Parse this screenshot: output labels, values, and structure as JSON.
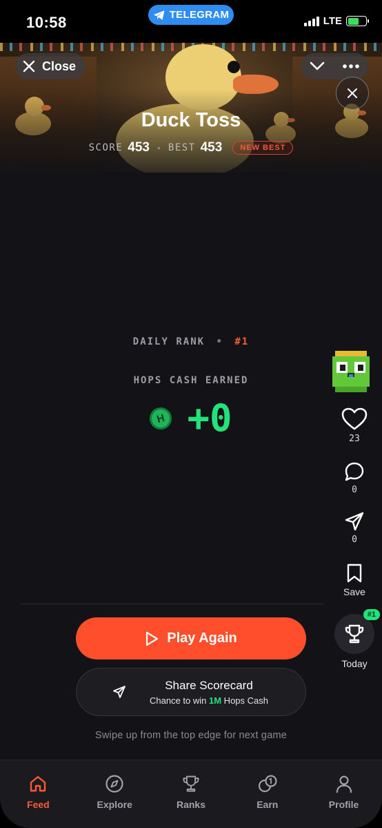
{
  "status_bar": {
    "time": "10:58",
    "app_pill": "TELEGRAM",
    "network": "LTE"
  },
  "header": {
    "close_label": "Close"
  },
  "game": {
    "title": "Duck Toss",
    "score_label": "SCORE",
    "score": "453",
    "best_label": "BEST",
    "best": "453",
    "badge": "NEW BEST"
  },
  "stats": {
    "daily_rank_label": "DAILY RANK",
    "separator": "•",
    "daily_rank": "#1",
    "hops_label": "HOPS CASH EARNED",
    "hops_amount": "+0",
    "coin_letter": "H"
  },
  "rail": {
    "likes": "23",
    "comments": "0",
    "shares": "0",
    "save_label": "Save",
    "trophy_badge": "#1",
    "trophy_label": "Today"
  },
  "actions": {
    "play_again": "Play Again",
    "share_title": "Share Scorecard",
    "share_sub_prefix": "Chance to win ",
    "share_sub_highlight": "1M",
    "share_sub_suffix": " Hops Cash",
    "swipe_hint": "Swipe up from the top edge for next game"
  },
  "bottom_nav": [
    {
      "label": "Feed",
      "icon": "home-icon",
      "active": true
    },
    {
      "label": "Explore",
      "icon": "compass-icon",
      "active": false
    },
    {
      "label": "Ranks",
      "icon": "trophy-icon",
      "active": false
    },
    {
      "label": "Earn",
      "icon": "coins-icon",
      "active": false
    },
    {
      "label": "Profile",
      "icon": "user-icon",
      "active": false
    }
  ],
  "colors": {
    "accent": "#ff4e2b",
    "money": "#22e37a",
    "background": "#121217"
  }
}
